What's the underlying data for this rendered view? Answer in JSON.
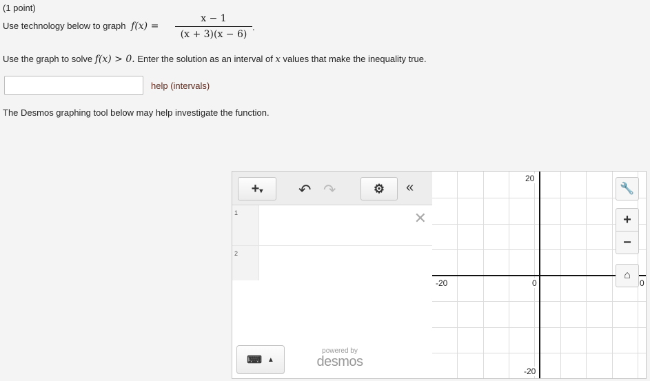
{
  "problem": {
    "points": "(1 point)",
    "q1_prefix": "Use technology below to graph",
    "function_lhs": "f(x) =",
    "numerator": "x − 1",
    "denominator": "(x + 3)(x − 6)",
    "q1_suffix": ".",
    "q2_prefix": "Use the graph to solve",
    "inequality": "f(x) > 0.",
    "q2_mid": "Enter the solution as an interval of",
    "q2_var": "x",
    "q2_suffix": "values that make the inequality true.",
    "answer_value": "",
    "help_link": "help (intervals)",
    "desmos_note": "The Desmos graphing tool below may help investigate the function."
  },
  "desmos": {
    "toolbar": {
      "add_icon": "plus-dropdown-icon",
      "undo_icon": "undo-icon",
      "redo_icon": "redo-icon",
      "settings_icon": "gear-icon",
      "collapse_icon": "double-chevron-left-icon"
    },
    "expressions": [
      {
        "number": "1",
        "value": ""
      },
      {
        "number": "2",
        "value": ""
      }
    ],
    "powered_by": "powered by",
    "logo": "desmos",
    "axis_labels": {
      "x_neg": "-20",
      "origin": "0",
      "x_pos_partial": "0",
      "y_pos": "20",
      "y_neg": "-20"
    },
    "side_buttons": [
      "wrench-icon",
      "zoom-in-icon",
      "zoom-out-icon",
      "home-icon"
    ]
  }
}
